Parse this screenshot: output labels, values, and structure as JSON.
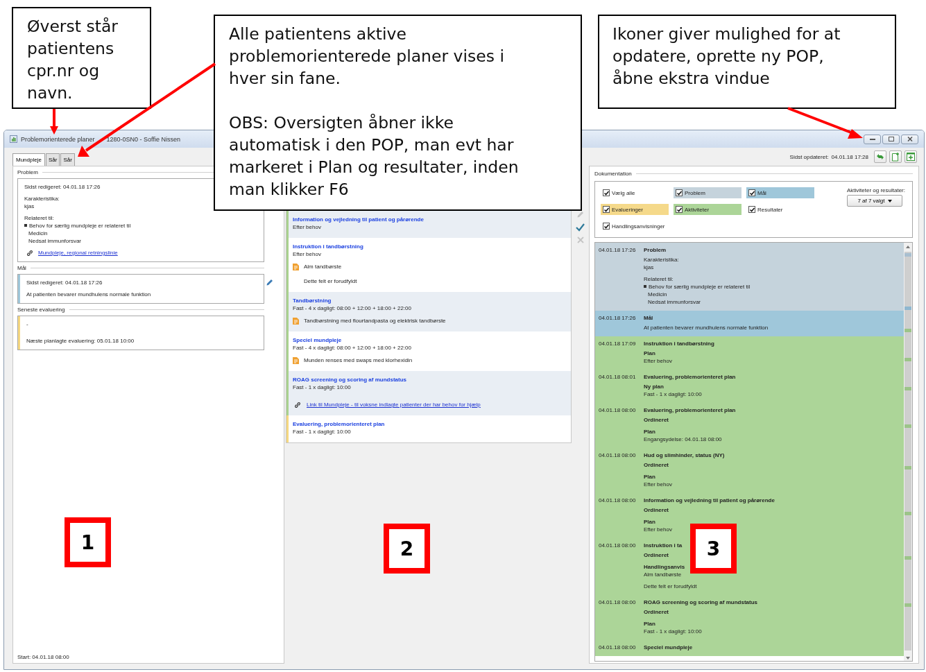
{
  "callouts": [
    {
      "paragraphs": [
        [
          "Øverst står",
          "patientens",
          "cpr.nr og",
          "navn."
        ]
      ]
    },
    {
      "paragraphs": [
        [
          "Alle patientens aktive",
          "problemorienterede planer vises i",
          "hver sin fane."
        ],
        [
          "OBS: Oversigten åbner ikke",
          "automatisk i den POP, man evt har",
          "markeret i Plan og resultater, inden",
          "man klikker F6"
        ]
      ]
    },
    {
      "paragraphs": [
        [
          "Ikoner giver mulighed for at",
          "opdatere, oprette ny POP,",
          "åbne ekstra vindue"
        ]
      ]
    }
  ],
  "markers": [
    {
      "label": "1"
    },
    {
      "label": "2"
    },
    {
      "label": "3"
    }
  ],
  "window": {
    "title_start": "Problemorienterede planer",
    "title_end": "1280-0SN0 - Soffie Nissen"
  },
  "tabs": [
    {
      "label": "Mundpleje",
      "selected": true
    },
    {
      "label": "Sår",
      "selected": false
    },
    {
      "label": "Sår",
      "selected": false
    }
  ],
  "last_updated": {
    "label": "Sidst opdateret:",
    "value": "04.01.18 17:28"
  },
  "left_sections": [
    {
      "heading": "Problem",
      "editable": false,
      "paragraphs": [
        [
          {
            "kind": "text",
            "text": "Sidst redigeret: 04.01.18 17:26"
          }
        ],
        [
          {
            "kind": "text",
            "text": "Karakteristika:"
          },
          {
            "kind": "text",
            "text": "kjas"
          }
        ],
        [
          {
            "kind": "text",
            "text": "Relateret til:"
          },
          {
            "kind": "bullet",
            "text": "Behov for særlig mundpleje er relateret til"
          },
          {
            "kind": "indent",
            "text": "Medicin"
          },
          {
            "kind": "indent",
            "text": "Nedsat immunforsvar"
          }
        ],
        [
          {
            "kind": "link",
            "text": "Mundpleje, regional retningslinie"
          }
        ]
      ]
    },
    {
      "heading": "Mål",
      "color": "#9fc7da",
      "editable": true,
      "paragraphs": [
        [
          {
            "kind": "text",
            "text": "Sidst redigeret: 04.01.18 17:26"
          }
        ],
        [
          {
            "kind": "text",
            "text": "At patienten bevarer mundhulens normale funktion"
          }
        ]
      ]
    },
    {
      "heading": "Seneste evaluering",
      "color": "#f5d77f",
      "editable": false,
      "paragraphs": [
        [
          {
            "kind": "text",
            "text": "-"
          }
        ],
        [
          {
            "kind": "text",
            "text": "Næste planlagte evaluering: 05.01.18 10:00"
          }
        ]
      ]
    }
  ],
  "start": "Start: 04.01.18 08:00",
  "activities": [
    {
      "title": "Information og vejledning til patient og pårørende",
      "schedule": "Efter behov",
      "color": "#a9d18e"
    },
    {
      "title": "Instruktion i tandbørstning",
      "schedule": "Efter behov",
      "color": "#a9d18e",
      "details": [
        {
          "kind": "note",
          "text": "Alm tandbørste"
        },
        {
          "kind": "plain",
          "text": "Dette felt er forudfyldt"
        }
      ]
    },
    {
      "title": "Tandbørstning",
      "schedule": "Fast - 4 x dagligt: 08:00 + 12:00 + 18:00 + 22:00",
      "color": "#a9d18e",
      "details": [
        {
          "kind": "note",
          "text": "Tandbørstning med flourtandpasta og elektrisk tandbørste"
        }
      ]
    },
    {
      "title": "Speciel mundpleje",
      "schedule": "Fast - 4 x dagligt: 08:00 + 12:00 + 18:00 + 22:00",
      "color": "#a9d18e",
      "details": [
        {
          "kind": "note",
          "text": "Munden renses med swaps med klorhexidin"
        }
      ]
    },
    {
      "title": "ROAG screening og scoring af mundstatus",
      "schedule": "Fast - 1 x dagligt: 10:00",
      "color": "#a9d18e",
      "details": [
        {
          "kind": "link",
          "text": "Link til Mundpleje - til voksne indlagte patienter der har behov for hjælp"
        }
      ]
    },
    {
      "title": "Evaluering, problemorienteret plan",
      "schedule": "Fast - 1 x dagligt: 10:00",
      "color": "#f5d77f"
    }
  ],
  "tools": [
    {
      "kind": "edit",
      "disabled": true
    },
    {
      "kind": "confirm",
      "disabled": false
    },
    {
      "kind": "cancel",
      "disabled": true
    }
  ],
  "documentation": {
    "heading": "Dokumentation",
    "filters": [
      {
        "label": "Vælg alle",
        "checked": true
      },
      {
        "label": "Problem",
        "checked": true,
        "color": "#c5d3dc"
      },
      {
        "label": "Mål",
        "checked": true,
        "color": "#9fc7da"
      },
      {
        "label": "Evalueringer",
        "checked": true,
        "color": "#f5d98a"
      },
      {
        "label": "Aktiviteter",
        "checked": true,
        "color": "#acd598"
      },
      {
        "label": "Resultater",
        "checked": true
      },
      {
        "label": "Handlingsanvisninger",
        "checked": true
      }
    ],
    "dropdown_label": "Aktiviteter og resultater:",
    "dropdown_value": "7 af 7 valgt",
    "entries": [
      {
        "time": "04.01.18 17:26",
        "title": "Problem",
        "color": "#c5d3dc",
        "paragraphs": [
          [
            {
              "kind": "text",
              "text": "Karakteristika:"
            },
            {
              "kind": "text",
              "text": "kjas"
            }
          ],
          [
            {
              "kind": "text",
              "text": "Relateret til:"
            },
            {
              "kind": "bullet",
              "text": "Behov for særlig mundpleje er relateret til"
            },
            {
              "kind": "indent",
              "text": "Medicin"
            },
            {
              "kind": "indent",
              "text": "Nedsat immunforsvar"
            }
          ]
        ]
      },
      {
        "time": "04.01.18 17:26",
        "title": "Mål",
        "color": "#9fc7da",
        "paragraphs": [
          [
            {
              "kind": "text",
              "text": "At patienten bevarer mundhulens normale funktion"
            }
          ]
        ]
      },
      {
        "time": "04.01.18 17:09",
        "title": "Instruktion i tandbørstning",
        "color": "#acd598",
        "paragraphs": [
          [
            {
              "kind": "bold",
              "text": "Plan"
            },
            {
              "kind": "text",
              "text": "Efter behov"
            }
          ]
        ]
      },
      {
        "time": "04.01.18 08:01",
        "title": "Evaluering, problemorienteret plan",
        "color": "#acd598",
        "paragraphs": [
          [
            {
              "kind": "bold",
              "text": "Ny plan"
            },
            {
              "kind": "text",
              "text": "Fast - 1 x dagligt: 10:00"
            }
          ]
        ]
      },
      {
        "time": "04.01.18 08:00",
        "title": "Evaluering, problemorienteret plan",
        "color": "#acd598",
        "paragraphs": [
          [
            {
              "kind": "bold",
              "text": "Ordineret"
            }
          ],
          [
            {
              "kind": "bold",
              "text": "Plan"
            },
            {
              "kind": "text",
              "text": "Engangsydelse: 04.01.18 08:00"
            }
          ]
        ]
      },
      {
        "time": "04.01.18 08:00",
        "title": "Hud og slimhinder, status (NY)",
        "color": "#acd598",
        "paragraphs": [
          [
            {
              "kind": "bold",
              "text": "Ordineret"
            }
          ],
          [
            {
              "kind": "bold",
              "text": "Plan"
            },
            {
              "kind": "text",
              "text": "Efter behov"
            }
          ]
        ]
      },
      {
        "time": "04.01.18 08:00",
        "title": "Information og vejledning til patient og pårørende",
        "color": "#acd598",
        "paragraphs": [
          [
            {
              "kind": "bold",
              "text": "Ordineret"
            }
          ],
          [
            {
              "kind": "bold",
              "text": "Plan"
            },
            {
              "kind": "text",
              "text": "Efter behov"
            }
          ]
        ]
      },
      {
        "time": "04.01.18 08:00",
        "title": "Instruktion i ta",
        "color": "#acd598",
        "paragraphs": [
          [
            {
              "kind": "bold",
              "text": "Ordineret"
            }
          ],
          [
            {
              "kind": "bold",
              "text": "Handlingsanvis"
            },
            {
              "kind": "text",
              "text": "Alm tandbørste"
            }
          ],
          [
            {
              "kind": "text",
              "text": "Dette felt er forudfyldt"
            }
          ]
        ]
      },
      {
        "time": "04.01.18 08:00",
        "title": "ROAG screening og scoring af mundstatus",
        "color": "#acd598",
        "paragraphs": [
          [
            {
              "kind": "bold",
              "text": "Ordineret"
            }
          ],
          [
            {
              "kind": "bold",
              "text": "Plan"
            },
            {
              "kind": "text",
              "text": "Fast - 1 x dagligt: 10:00"
            }
          ]
        ]
      },
      {
        "time": "04.01.18 08:00",
        "title": "Speciel mundpleje",
        "color": "#acd598"
      }
    ]
  }
}
